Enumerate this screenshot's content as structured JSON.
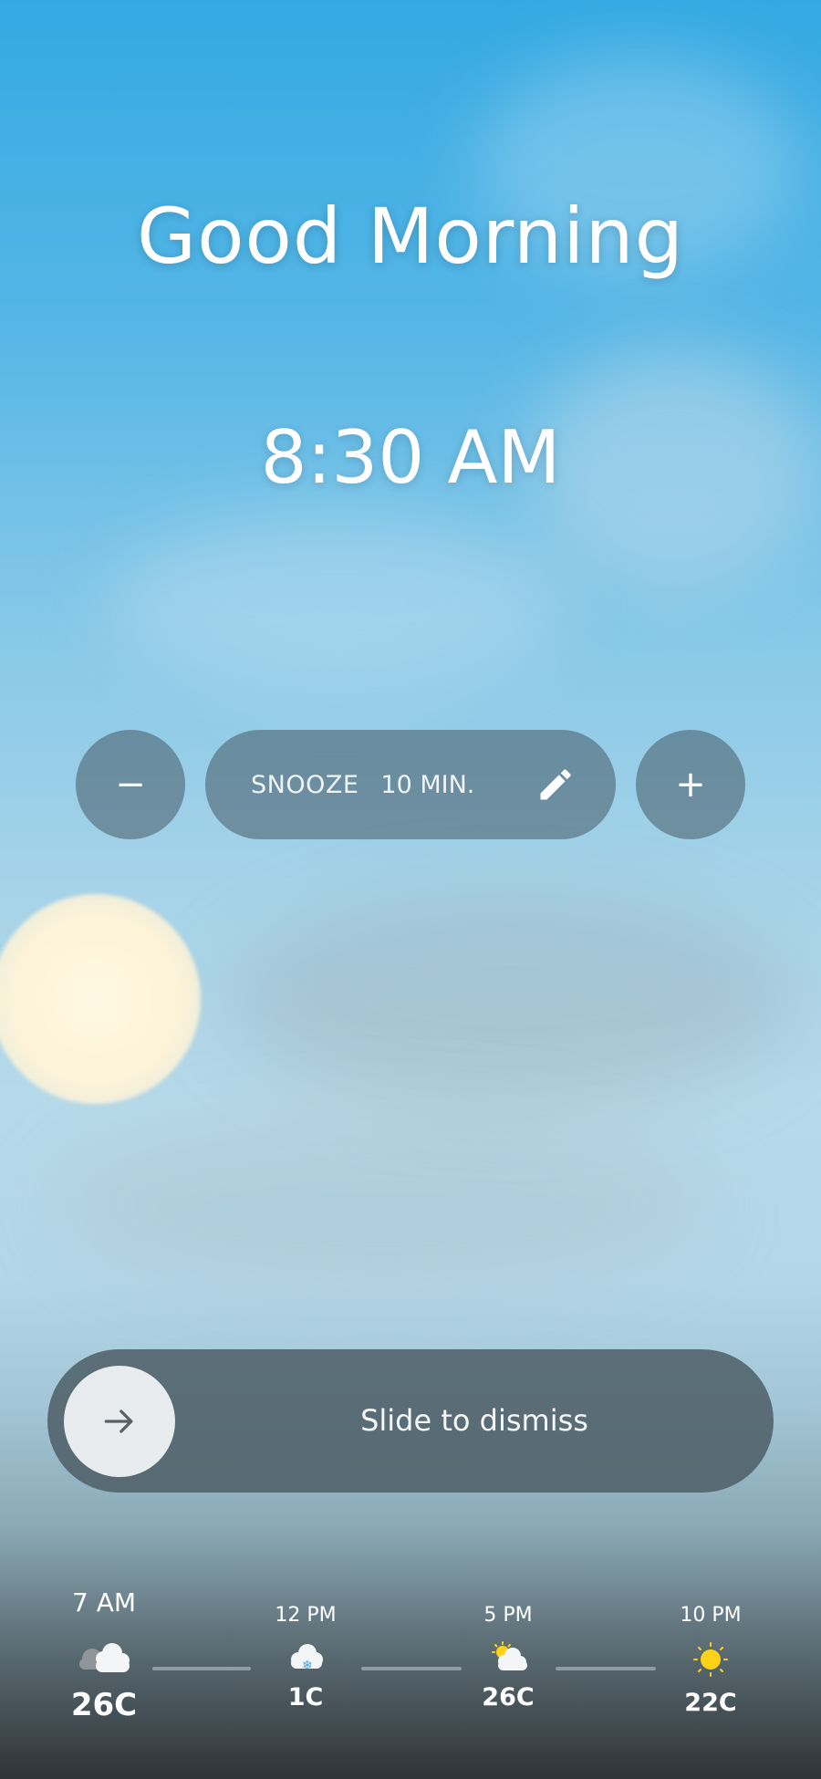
{
  "greeting": "Good Morning",
  "alarm_time": "8:30 AM",
  "snooze": {
    "decrease_label": "−",
    "label": "SNOOZE",
    "value": "10 MIN.",
    "increase_label": "+",
    "edit_icon": "pencil-icon"
  },
  "dismiss": {
    "label": "Slide to dismiss",
    "knob_icon": "arrow-right-icon"
  },
  "forecast": [
    {
      "time": "7 AM",
      "temp": "26C",
      "icon": "cloudy-icon"
    },
    {
      "time": "12 PM",
      "temp": "1C",
      "icon": "snow-cloud-icon"
    },
    {
      "time": "5 PM",
      "temp": "26C",
      "icon": "partly-sunny-icon"
    },
    {
      "time": "10 PM",
      "temp": "22C",
      "icon": "sun-icon"
    }
  ],
  "colors": {
    "sky_top": "#33a9e2",
    "control_bg": "#465a64",
    "sun_icon": "#ffd21a"
  }
}
